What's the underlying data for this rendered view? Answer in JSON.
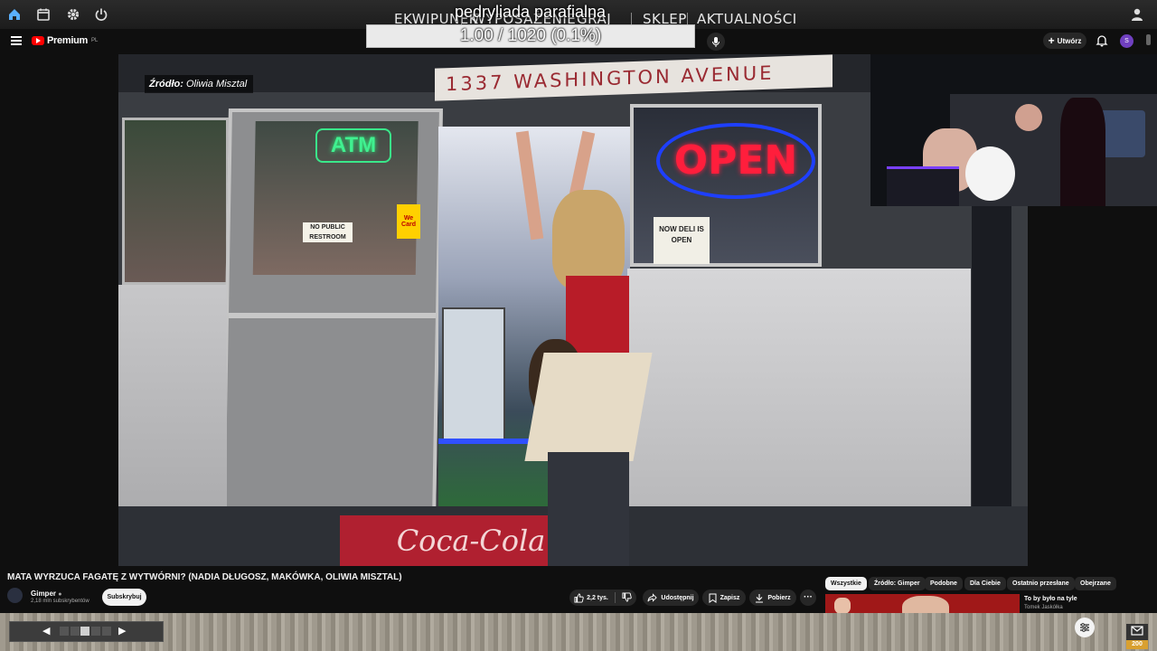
{
  "game_bar": {
    "nav": [
      "EKWIPUNEK",
      "WYPOSAŻENIE",
      "GRAJ",
      "SKLEP",
      "AKTUALNOŚCI"
    ],
    "stream_title": "pedryliada parafialna",
    "progress_text": "1.00 / 1020 (0.1%)"
  },
  "youtube_bar": {
    "logo_text": "Premium",
    "logo_region": "PL",
    "create_label": "Utwórz",
    "avatar_letter": "S"
  },
  "video": {
    "source_tag_label": "Źródło:",
    "source_tag_name": "Oliwia Misztal",
    "scene_text": {
      "street_sign": "1337 WASHINGTON AVENUE",
      "neon_atm": "ATM",
      "neon_open": "OPEN",
      "sign_no_restroom": "NO PUBLIC RESTROOM",
      "sign_we_card": "We Card",
      "sign_deli": "NOW DELI IS OPEN",
      "mat_logo": "Coca-Cola"
    }
  },
  "below_video": {
    "title": "MATA WYRZUCA FAGATĘ Z WYTWÓRNI? (NADIA DŁUGOSZ, MAKÓWKA, OLIWIA MISZTAL)",
    "channel_name": "Gimper",
    "channel_subs": "2,18 mln subskrybentów",
    "subscribe_label": "Subskrybuj",
    "likes": "2,2 tys.",
    "share_label": "Udostępnij",
    "save_label": "Zapisz",
    "download_label": "Pobierz"
  },
  "chips": [
    "Wszystkie",
    "Źródło: Gimper",
    "Podobne",
    "Dla Ciebie",
    "Ostatnio przesłane",
    "Obejrzane"
  ],
  "recommendation": {
    "title": "To by było na tyle",
    "channel": "Tomek Jaskółka"
  },
  "mail_count": "200",
  "colors": {
    "youtube_red": "#ff0000",
    "accent_blue": "#3ea6ff",
    "dark_bg": "#0f0f0f"
  }
}
